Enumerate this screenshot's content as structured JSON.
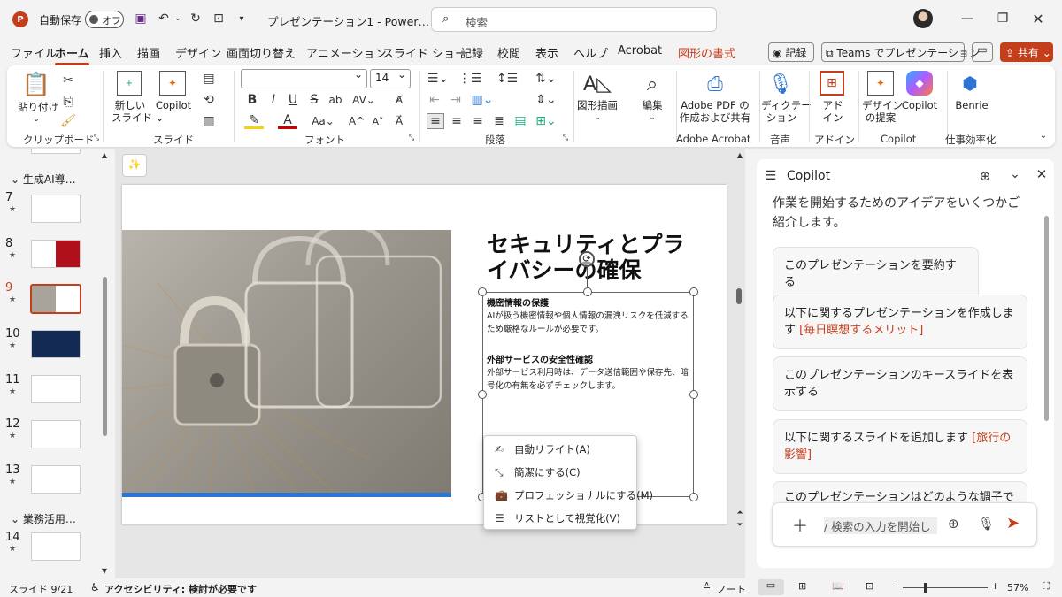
{
  "titlebar": {
    "autosave_label": "自動保存",
    "autosave_state": "オフ",
    "doc_title": "プレゼンテーション1 -  Power…",
    "search_placeholder": "検索"
  },
  "tabs": [
    "ファイル",
    "ホーム",
    "挿入",
    "描画",
    "デザイン",
    "画面切り替え",
    "アニメーション",
    "スライド ショー",
    "記録",
    "校閲",
    "表示",
    "ヘルプ",
    "Acrobat",
    "図形の書式"
  ],
  "tab_right": {
    "record": "記録",
    "teams": "Teams でプレゼンテーション",
    "share": "共有"
  },
  "ribbon": {
    "paste": "貼り付け",
    "new_slide": "新しい\nスライド",
    "copilot": "Copilot",
    "font_name": "",
    "font_size": "14",
    "shape_draw": "図形描画",
    "edit": "編集",
    "adobe_pdf": "Adobe PDF の\n作成および共有",
    "dictate": "ディクテー\nション",
    "addin": "アド\nイン",
    "design_idea": "デザイン\nの提案",
    "copilot2": "Copilot",
    "benrie": "Benrie",
    "groups": {
      "clipboard": "クリップボード",
      "slide": "スライド",
      "font": "フォント",
      "paragraph": "段落",
      "adobe": "Adobe Acrobat",
      "voice": "音声",
      "addin": "アドイン",
      "copilot": "Copilot",
      "work": "仕事効率化"
    }
  },
  "thumbs": {
    "section1": "生成AI導…",
    "section2": "業務活用…",
    "slides": [
      {
        "num": "7"
      },
      {
        "num": "8"
      },
      {
        "num": "9"
      },
      {
        "num": "10"
      },
      {
        "num": "11"
      },
      {
        "num": "12"
      },
      {
        "num": "13"
      },
      {
        "num": "14"
      }
    ]
  },
  "slide": {
    "title": "セキュリティとプライバシーの確保",
    "h1": "機密情報の保護",
    "p1": "AIが扱う機密情報や個人情報の漏洩リスクを低減するため厳格なルールが必要です。",
    "h2": "外部サービスの安全性確認",
    "p2": "外部サービス利用時は、データ送信範囲や保存先、暗号化の有無を必ずチェックします。"
  },
  "context_menu": [
    {
      "label": "自動リライト(A)",
      "icon": "rewrite-icon"
    },
    {
      "label": "簡潔にする(C)",
      "icon": "shrink-icon"
    },
    {
      "label": "プロフェッショナルにする(M)",
      "icon": "briefcase-icon"
    },
    {
      "label": "リストとして視覚化(V)",
      "icon": "list-icon"
    }
  ],
  "copilot": {
    "title": "Copilot",
    "intro": "作業を開始するためのアイデアをいくつかご紹介します。",
    "cards": [
      {
        "text": "このプレゼンテーションを要約する",
        "highlight": ""
      },
      {
        "text": "以下に関するプレゼンテーションを作成します ",
        "highlight": "[毎日瞑想するメリット]"
      },
      {
        "text": "このプレゼンテーションのキースライドを表示する",
        "highlight": ""
      },
      {
        "text": "以下に関するスライドを追加します ",
        "highlight": "[旅行の影響]"
      },
      {
        "text": "このプレゼンテーションはどのような調子で",
        "highlight": ""
      }
    ],
    "input_placeholder": "/ 検索の入力を開始し"
  },
  "status": {
    "slide": "スライド 9/21",
    "accessibility": "アクセシビリティ: 検討が必要です",
    "notes": "ノート",
    "zoom": "57%"
  },
  "colors": {
    "accent": "#c43e1c",
    "blue": "#2e75d3"
  }
}
